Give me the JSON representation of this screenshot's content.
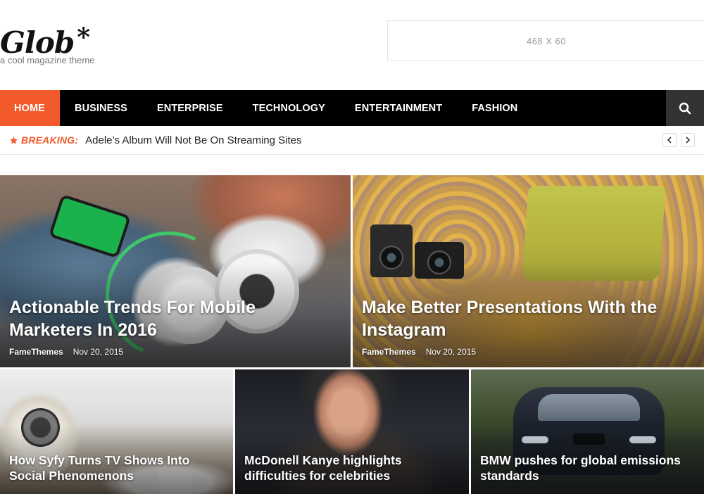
{
  "site": {
    "logo": "Glob",
    "logo_mark": "*",
    "tagline": "a cool magazine theme",
    "ad_placeholder": "468 X 60"
  },
  "nav": {
    "items": [
      "HOME",
      "BUSINESS",
      "ENTERPRISE",
      "TECHNOLOGY",
      "ENTERTAINMENT",
      "FASHION"
    ],
    "active": "HOME",
    "search_icon": "search-icon"
  },
  "breaking": {
    "label": "BREAKING:",
    "headline": "Adele’s Album Will Not Be On Streaming Sites",
    "icon": "star-icon"
  },
  "featured": [
    {
      "title": "Actionable Trends For Mobile Marketers In 2016",
      "author": "FameThemes",
      "date": "Nov 20, 2015"
    },
    {
      "title": "Make Better Presentations With the Instagram",
      "author": "FameThemes",
      "date": "Nov 20, 2015"
    }
  ],
  "secondary": [
    {
      "title": "How Syfy Turns TV Shows Into Social Phenomenons"
    },
    {
      "title": "McDonell Kanye highlights difficulties for celebrities"
    },
    {
      "title": "BMW pushes for global emissions standards"
    }
  ],
  "colors": {
    "accent": "#f25a2b",
    "nav_bg": "#000000",
    "search_bg": "#333333"
  }
}
